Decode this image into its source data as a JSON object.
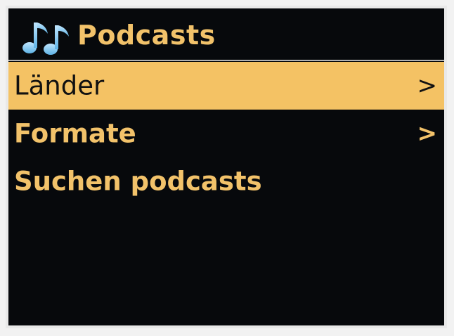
{
  "header": {
    "title": "Podcasts",
    "icon": "music-notes-icon"
  },
  "menu": {
    "items": [
      {
        "label": "Länder",
        "arrow": ">",
        "selected": true
      },
      {
        "label": "Formate",
        "arrow": ">",
        "selected": false
      },
      {
        "label": "Suchen podcasts",
        "arrow": "",
        "selected": false
      }
    ]
  },
  "colors": {
    "background": "#07090c",
    "accent_text": "#f2c26a",
    "selection_bar": "#f4c264",
    "selected_text": "#111111",
    "icon_blue": "#7cc4ee"
  }
}
